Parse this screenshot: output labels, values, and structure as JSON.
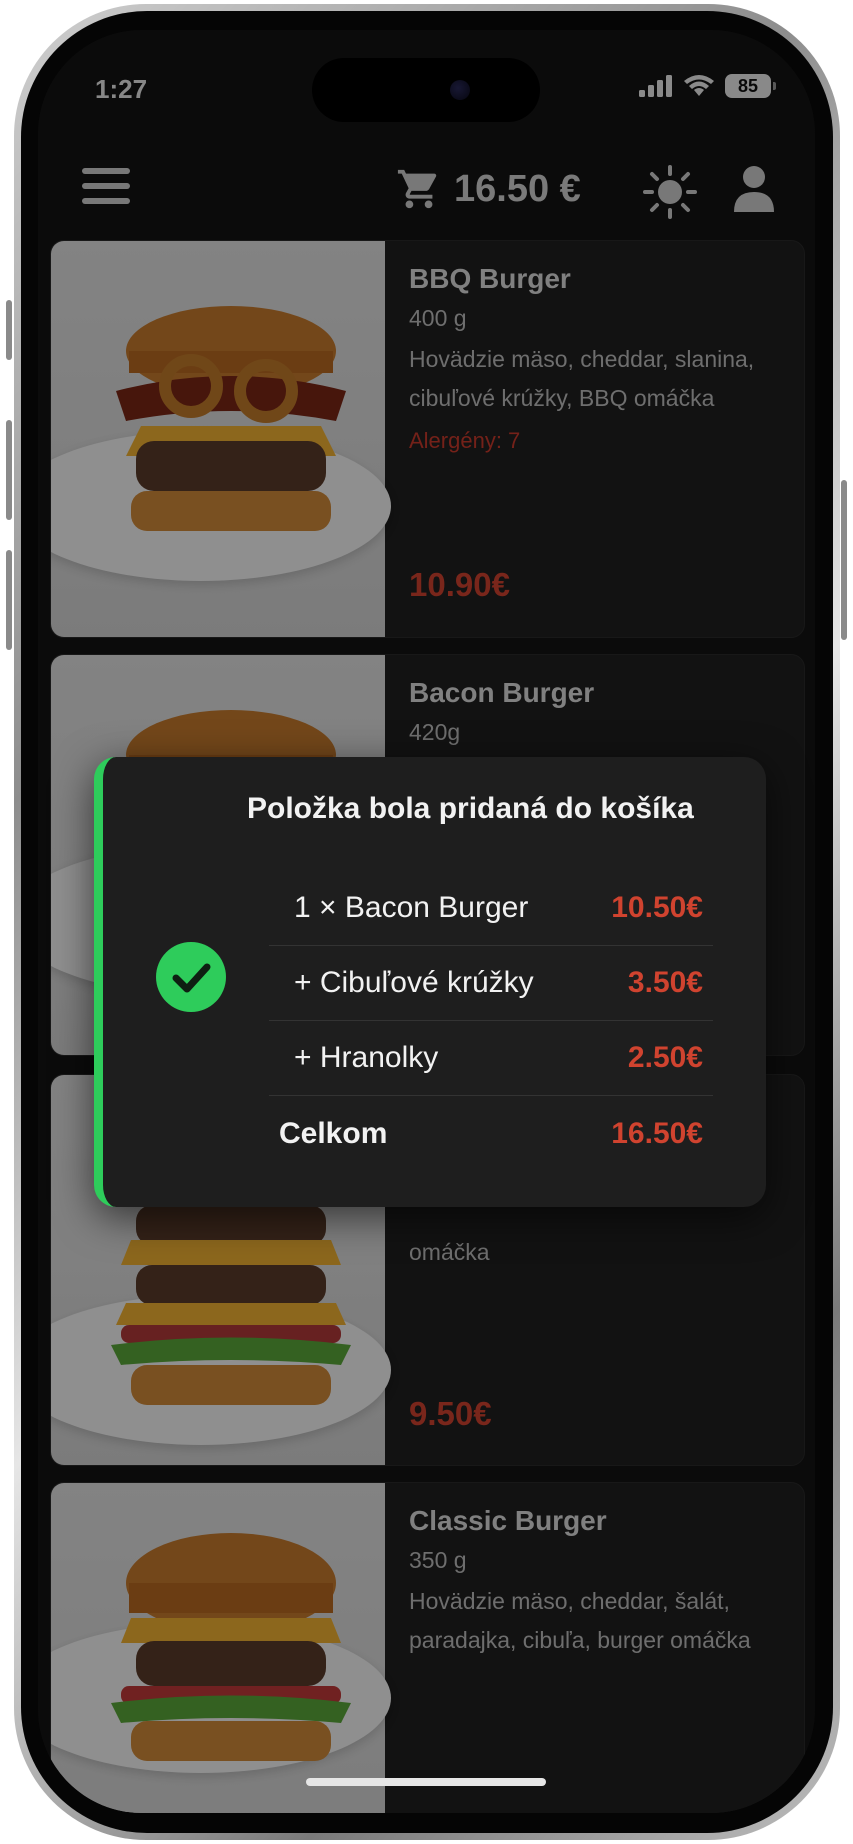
{
  "status_bar": {
    "time": "1:27",
    "battery": "85"
  },
  "header": {
    "menu_icon": "hamburger-menu-icon",
    "cart_icon": "shopping-cart-icon",
    "cart_total": "16.50 €",
    "theme_icon": "sun-icon",
    "user_icon": "user-icon"
  },
  "products": [
    {
      "name": "BBQ Burger",
      "weight": "400 g",
      "description": "Hovädzie mäso, cheddar, slanina, cibuľové krúžky, BBQ omáčka",
      "allergens": "Alergény: 7",
      "price": "10.90€"
    },
    {
      "name": "Bacon Burger",
      "weight": "420g"
    },
    {
      "description": "omáčka",
      "price": "9.50€"
    },
    {
      "name": "Classic Burger",
      "weight": "350 g",
      "description": "Hovädzie mäso, cheddar, šalát, paradajka, cibuľa, burger omáčka"
    }
  ],
  "toast": {
    "title": "Položka bola pridaná do košíka",
    "icon": "checkmark-circle-icon",
    "items": [
      {
        "label": "1 × Bacon Burger",
        "price": "10.50€"
      },
      {
        "label": "+ Cibuľové krúžky",
        "price": "3.50€"
      },
      {
        "label": "+ Hranolky",
        "price": "2.50€"
      }
    ],
    "total_label": "Celkom",
    "total_price": "16.50€"
  },
  "colors": {
    "accent_price": "#d0432f",
    "success": "#2ecc5b",
    "background": "#141414",
    "card": "#1f1f1f"
  }
}
